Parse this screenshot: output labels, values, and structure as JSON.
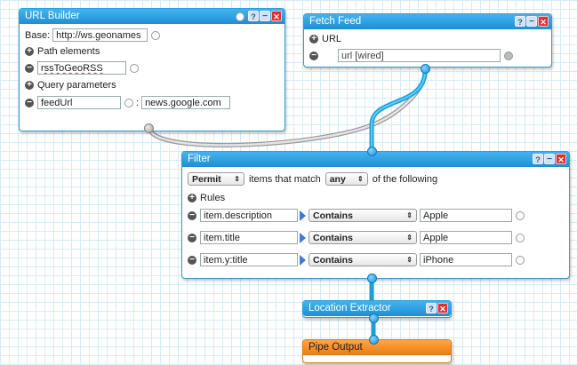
{
  "colors": {
    "accent": "#2e9ede",
    "output_accent": "#e07a10",
    "wire": "#29b4ec"
  },
  "url_builder": {
    "title": "URL Builder",
    "base_label": "Base:",
    "base_value": "http://ws.geonames",
    "path_section": "Path elements",
    "path_value": "rssToGeoRSS",
    "query_section": "Query parameters",
    "query_key": "feedUrl",
    "query_separator": ":",
    "query_value": "news.google.com"
  },
  "fetch_feed": {
    "title": "Fetch Feed",
    "url_section": "URL",
    "url_value": "url [wired]"
  },
  "filter": {
    "title": "Filter",
    "mode": "Permit",
    "items_match_text": "items that match",
    "match": "any",
    "following_text": "of the following",
    "rules_label": "Rules",
    "rules": [
      {
        "field": "item.description",
        "operator": "Contains",
        "value": "Apple"
      },
      {
        "field": "item.title",
        "operator": "Contains",
        "value": "Apple"
      },
      {
        "field": "item.y:title",
        "operator": "Contains",
        "value": "iPhone"
      }
    ]
  },
  "location_extractor": {
    "title": "Location Extractor"
  },
  "pipe_output": {
    "title": "Pipe Output"
  },
  "icons": {
    "help": "help-icon",
    "minimize": "minimize-icon",
    "close": "close-icon",
    "add": "add-icon",
    "remove": "remove-icon"
  },
  "glyphs": {
    "help": "?",
    "minimize": "−",
    "close": "✕",
    "add": "+",
    "remove": "−",
    "select_arrows": "⇕"
  }
}
